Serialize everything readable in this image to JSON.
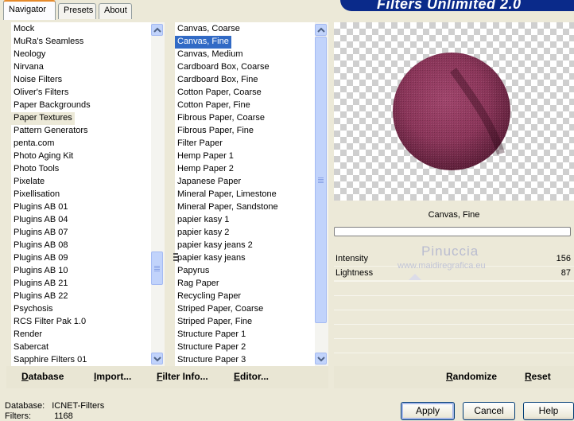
{
  "banner": {
    "title": "Filters Unlimited 2.0"
  },
  "tabs": [
    {
      "label": "Navigator",
      "active": true
    },
    {
      "label": "Presets",
      "active": false
    },
    {
      "label": "About",
      "active": false
    }
  ],
  "categories": {
    "items": [
      "Mock",
      "MuRa's Seamless",
      "Neology",
      "Nirvana",
      "Noise Filters",
      "Oliver's Filters",
      "Paper Backgrounds",
      "Paper Textures",
      "Pattern Generators",
      "penta.com",
      "Photo Aging Kit",
      "Photo Tools",
      "Pixelate",
      "Pixellisation",
      "Plugins AB 01",
      "Plugins AB 04",
      "Plugins AB 07",
      "Plugins AB 08",
      "Plugins AB 09",
      "Plugins AB 10",
      "Plugins AB 21",
      "Plugins AB 22",
      "Psychosis",
      "RCS Filter Pak 1.0",
      "Render",
      "Sabercat",
      "Sapphire Filters 01"
    ],
    "selected": "Paper Textures"
  },
  "filters": {
    "items": [
      "Canvas, Coarse",
      "Canvas, Fine",
      "Canvas, Medium",
      "Cardboard Box, Coarse",
      "Cardboard Box, Fine",
      "Cotton Paper, Coarse",
      "Cotton Paper, Fine",
      "Fibrous Paper, Coarse",
      "Fibrous Paper, Fine",
      "Filter Paper",
      "Hemp Paper 1",
      "Hemp Paper 2",
      "Japanese Paper",
      "Mineral Paper, Limestone",
      "Mineral Paper, Sandstone",
      "papier kasy 1",
      "papier kasy 2",
      "papier kasy jeans 2",
      "papier kasy jeans",
      "Papyrus",
      "Rag Paper",
      "Recycling Paper",
      "Striped Paper, Coarse",
      "Striped Paper, Fine",
      "Structure Paper 1",
      "Structure Paper 2",
      "Structure Paper 3"
    ],
    "selected": "Canvas, Fine"
  },
  "preview": {
    "filter_name": "Canvas, Fine",
    "progress": 0
  },
  "params": [
    {
      "label": "Intensity",
      "value": "156"
    },
    {
      "label": "Lightness",
      "value": "87"
    }
  ],
  "watermark": {
    "name": "Pinuccia",
    "url": "www.maidiregrafica.eu"
  },
  "bottom_links": {
    "database": "Database",
    "import": "Import...",
    "filter_info": "Filter Info...",
    "editor": "Editor...",
    "randomize": "Randomize",
    "reset": "Reset"
  },
  "status": {
    "database_label": "Database:",
    "database_value": "ICNET-Filters",
    "filters_label": "Filters:",
    "filters_value": "1168"
  },
  "buttons": {
    "apply": "Apply",
    "cancel": "Cancel",
    "help": "Help"
  },
  "colors": {
    "selection": "#316ac5",
    "accent_tab": "#e68b2c",
    "banner": "#0a2a8a"
  }
}
